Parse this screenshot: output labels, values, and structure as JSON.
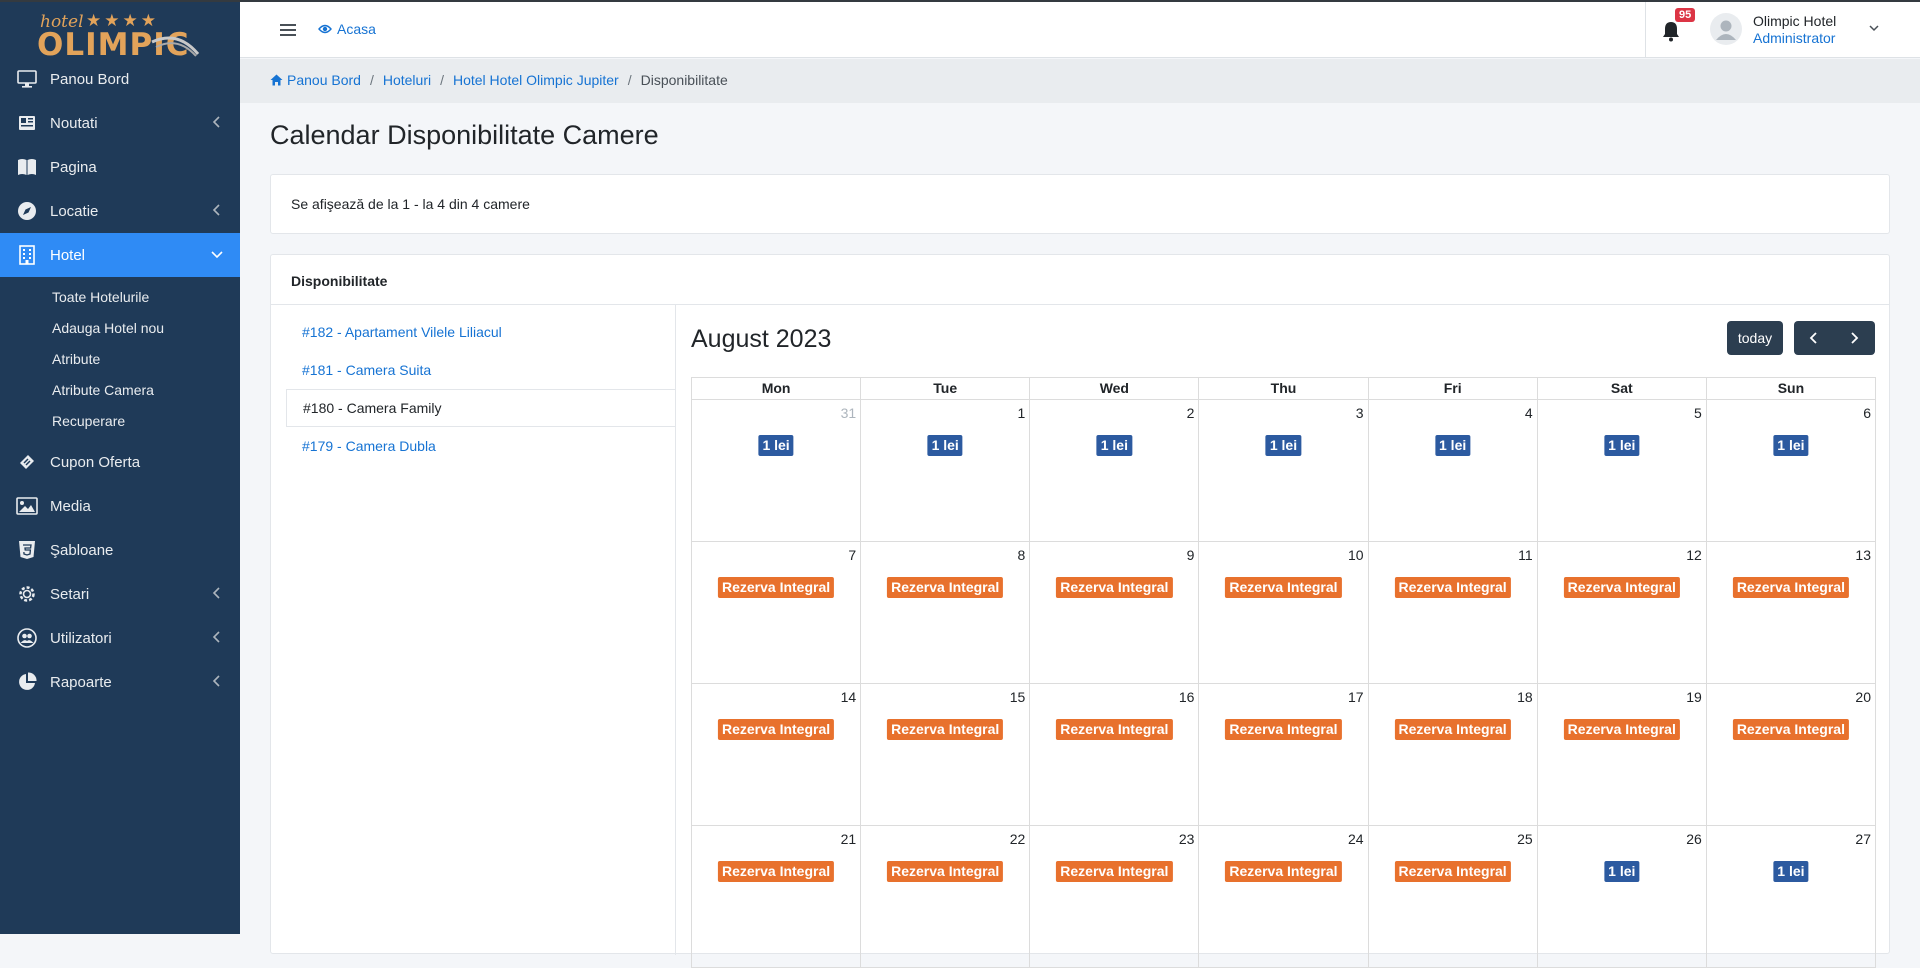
{
  "brand": {
    "small": "hotel",
    "stars": "★★★★",
    "big": "OLIMPIC"
  },
  "sidebar": {
    "items": [
      {
        "label": "Panou Bord",
        "icon": "monitor-icon"
      },
      {
        "label": "Noutati",
        "icon": "newspaper-icon",
        "has_children": true
      },
      {
        "label": "Pagina",
        "icon": "book-icon"
      },
      {
        "label": "Locatie",
        "icon": "compass-icon",
        "has_children": true
      },
      {
        "label": "Hotel",
        "icon": "building-icon",
        "has_children": true,
        "active": true
      },
      {
        "label": "Cupon Oferta",
        "icon": "ticket-icon"
      },
      {
        "label": "Media",
        "icon": "image-icon"
      },
      {
        "label": "Şabloane",
        "icon": "html5-icon"
      },
      {
        "label": "Setari",
        "icon": "gear-icon",
        "has_children": true
      },
      {
        "label": "Utilizatori",
        "icon": "users-icon",
        "has_children": true
      },
      {
        "label": "Rapoarte",
        "icon": "pie-chart-icon",
        "has_children": true
      }
    ],
    "hotel_submenu": [
      "Toate Hotelurile",
      "Adauga Hotel nou",
      "Atribute",
      "Atribute Camera",
      "Recuperare"
    ]
  },
  "header": {
    "home_label": "Acasa",
    "notifications": "95",
    "user_name": "Olimpic Hotel",
    "user_role": "Administrator"
  },
  "breadcrumb": [
    "Panou Bord",
    "Hoteluri",
    "Hotel Hotel Olimpic Jupiter",
    "Disponibilitate"
  ],
  "page_title": "Calendar Disponibilitate Camere",
  "summary_text": "Se afişează de la 1 - la 4 din 4 camere",
  "availability": {
    "title": "Disponibilitate",
    "rooms": [
      {
        "label": "#182 - Apartament Vilele Liliacul",
        "active": false
      },
      {
        "label": "#181 - Camera Suita",
        "active": false
      },
      {
        "label": "#180 - Camera Family",
        "active": true
      },
      {
        "label": "#179 - Camera Dubla",
        "active": false
      }
    ]
  },
  "calendar": {
    "title": "August 2023",
    "today_label": "today",
    "weekdays": [
      "Mon",
      "Tue",
      "Wed",
      "Thu",
      "Fri",
      "Sat",
      "Sun"
    ],
    "weeks": [
      [
        {
          "day": "31",
          "other": true,
          "event": "1 lei",
          "type": "free"
        },
        {
          "day": "1",
          "event": "1 lei",
          "type": "free"
        },
        {
          "day": "2",
          "event": "1 lei",
          "type": "free"
        },
        {
          "day": "3",
          "event": "1 lei",
          "type": "free"
        },
        {
          "day": "4",
          "event": "1 lei",
          "type": "free"
        },
        {
          "day": "5",
          "event": "1 lei",
          "type": "free"
        },
        {
          "day": "6",
          "event": "1 lei",
          "type": "free"
        }
      ],
      [
        {
          "day": "7",
          "event": "Rezerva Integral",
          "type": "booked"
        },
        {
          "day": "8",
          "event": "Rezerva Integral",
          "type": "booked"
        },
        {
          "day": "9",
          "event": "Rezerva Integral",
          "type": "booked"
        },
        {
          "day": "10",
          "event": "Rezerva Integral",
          "type": "booked"
        },
        {
          "day": "11",
          "event": "Rezerva Integral",
          "type": "booked"
        },
        {
          "day": "12",
          "event": "Rezerva Integral",
          "type": "booked"
        },
        {
          "day": "13",
          "event": "Rezerva Integral",
          "type": "booked"
        }
      ],
      [
        {
          "day": "14",
          "event": "Rezerva Integral",
          "type": "booked"
        },
        {
          "day": "15",
          "event": "Rezerva Integral",
          "type": "booked"
        },
        {
          "day": "16",
          "event": "Rezerva Integral",
          "type": "booked"
        },
        {
          "day": "17",
          "event": "Rezerva Integral",
          "type": "booked"
        },
        {
          "day": "18",
          "event": "Rezerva Integral",
          "type": "booked"
        },
        {
          "day": "19",
          "event": "Rezerva Integral",
          "type": "booked"
        },
        {
          "day": "20",
          "event": "Rezerva Integral",
          "type": "booked"
        }
      ],
      [
        {
          "day": "21",
          "event": "Rezerva Integral",
          "type": "booked"
        },
        {
          "day": "22",
          "event": "Rezerva Integral",
          "type": "booked"
        },
        {
          "day": "23",
          "event": "Rezerva Integral",
          "type": "booked"
        },
        {
          "day": "24",
          "event": "Rezerva Integral",
          "type": "booked"
        },
        {
          "day": "25",
          "event": "Rezerva Integral",
          "type": "booked"
        },
        {
          "day": "26",
          "event": "1 lei",
          "type": "free"
        },
        {
          "day": "27",
          "event": "1 lei",
          "type": "free"
        }
      ]
    ]
  },
  "colors": {
    "sidebar_bg": "#1f3a58",
    "active": "#2f8bf5",
    "link": "#1673d3",
    "free": "#2c5aa0",
    "booked": "#e8712d",
    "badge": "#dc3545"
  }
}
